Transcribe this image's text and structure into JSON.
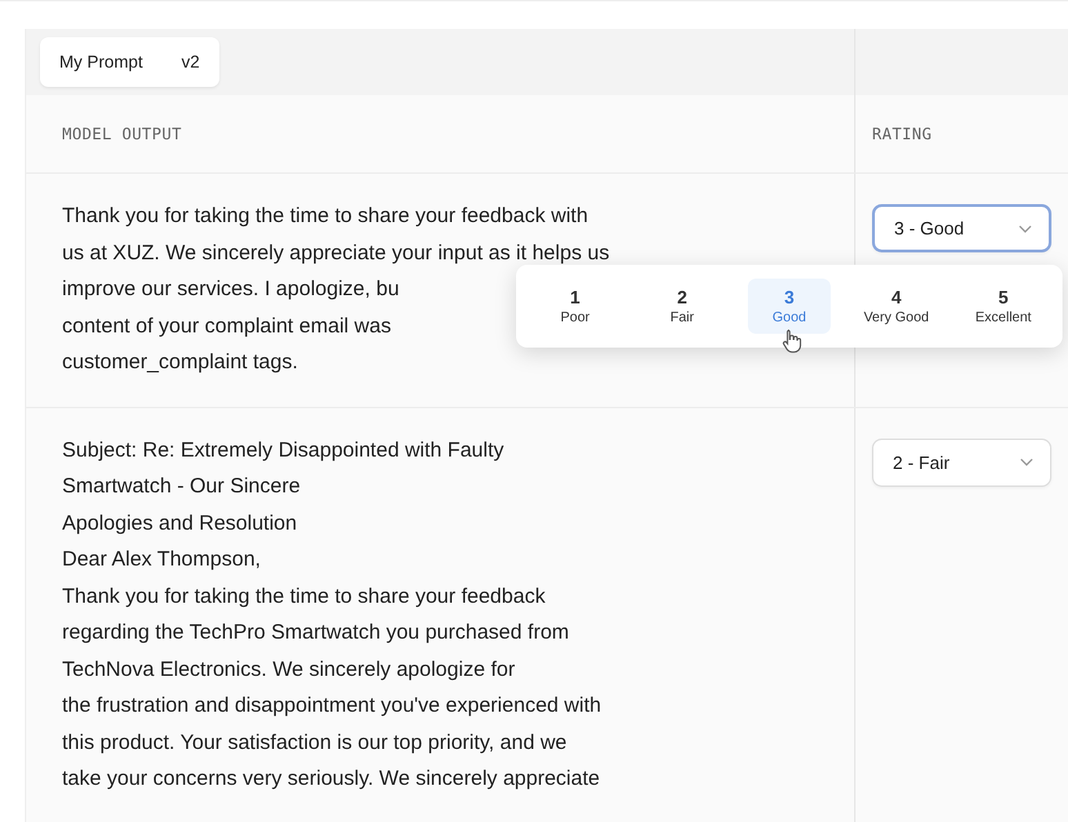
{
  "tabs": [
    {
      "label": "My Prompt"
    },
    {
      "label": "v2"
    }
  ],
  "columns": [
    "MODEL OUTPUT",
    "RATING"
  ],
  "rows": [
    {
      "lines": [
        "Thank you for taking the time to share your feedback with",
        "us at XUZ. We sincerely appreciate your input as it helps us",
        "improve our services. I apologize, bu",
        "content of your complaint email was",
        "customer_complaint tags."
      ],
      "rating": "3 - Good",
      "open": true
    },
    {
      "lines": [
        "Subject: Re: Extremely Disappointed with Faulty",
        "Smartwatch - Our Sincere",
        "Apologies and Resolution",
        "Dear Alex Thompson,",
        "Thank you for taking the time to share your feedback",
        "regarding the TechPro Smartwatch you purchased from",
        "TechNova Electronics. We sincerely apologize for",
        "the frustration and disappointment you've experienced with",
        "this product. Your satisfaction is our top priority, and we",
        "take your concerns very seriously. We sincerely appreciate"
      ],
      "rating": "2 - Fair",
      "open": false
    }
  ],
  "rating_options": [
    {
      "number": "1",
      "label": "Poor",
      "selected": false
    },
    {
      "number": "2",
      "label": "Fair",
      "selected": false
    },
    {
      "number": "3",
      "label": "Good",
      "selected": true
    },
    {
      "number": "4",
      "label": "Very Good",
      "selected": false
    },
    {
      "number": "5",
      "label": "Excellent",
      "selected": false
    }
  ]
}
